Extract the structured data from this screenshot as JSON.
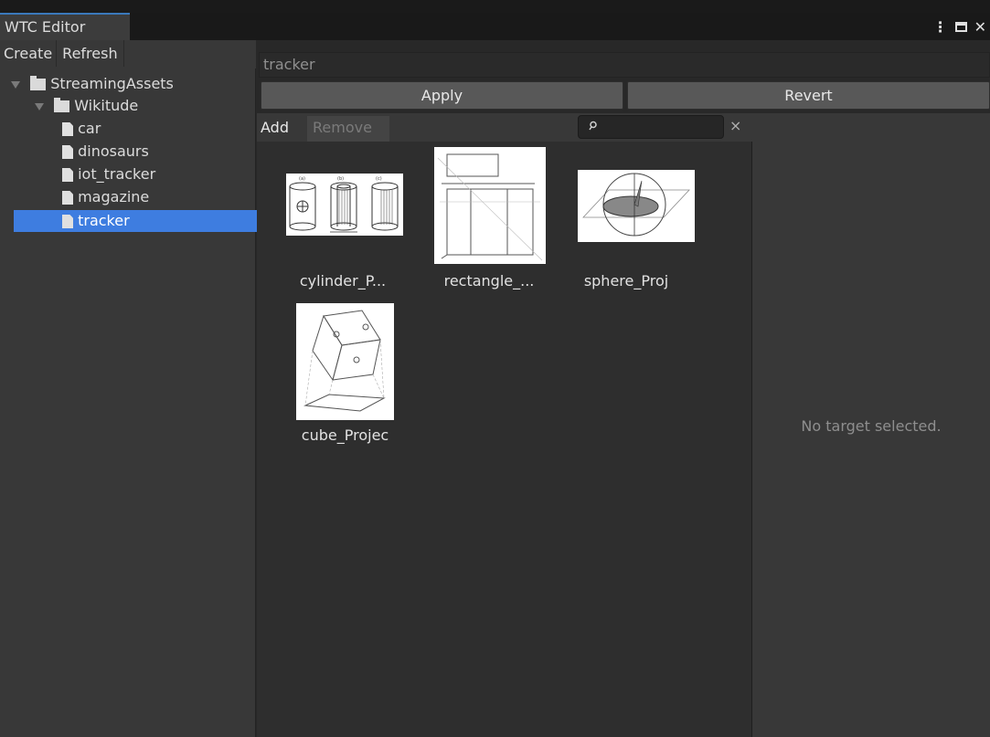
{
  "window": {
    "tab_title": "WTC Editor",
    "controls": {
      "menu_glyph": "⋮",
      "close_glyph": "✕"
    }
  },
  "left_panel": {
    "toolbar": {
      "create_label": "Create",
      "refresh_label": "Refresh"
    },
    "tree": [
      {
        "label": "StreamingAssets",
        "type": "folder",
        "depth": 0,
        "expanded": true
      },
      {
        "label": "Wikitude",
        "type": "folder",
        "depth": 1,
        "expanded": true
      },
      {
        "label": "car",
        "type": "file",
        "depth": 2
      },
      {
        "label": "dinosaurs",
        "type": "file",
        "depth": 2
      },
      {
        "label": "iot_tracker",
        "type": "file",
        "depth": 2
      },
      {
        "label": "magazine",
        "type": "file",
        "depth": 2
      },
      {
        "label": "tracker",
        "type": "file",
        "depth": 2,
        "selected": true
      }
    ]
  },
  "main": {
    "name_field_value": "tracker",
    "apply_label": "Apply",
    "revert_label": "Revert",
    "gallery_toolbar": {
      "add_label": "Add",
      "remove_label": "Remove",
      "clear_glyph": "×"
    },
    "targets": [
      {
        "label": "cylinder_P..."
      },
      {
        "label": "rectangle_..."
      },
      {
        "label": "sphere_Proj"
      },
      {
        "label": "cube_Projec"
      }
    ]
  },
  "details": {
    "empty_message": "No target selected."
  },
  "colors": {
    "selection": "#3e7de0",
    "tab_accent": "#3a79bb"
  }
}
